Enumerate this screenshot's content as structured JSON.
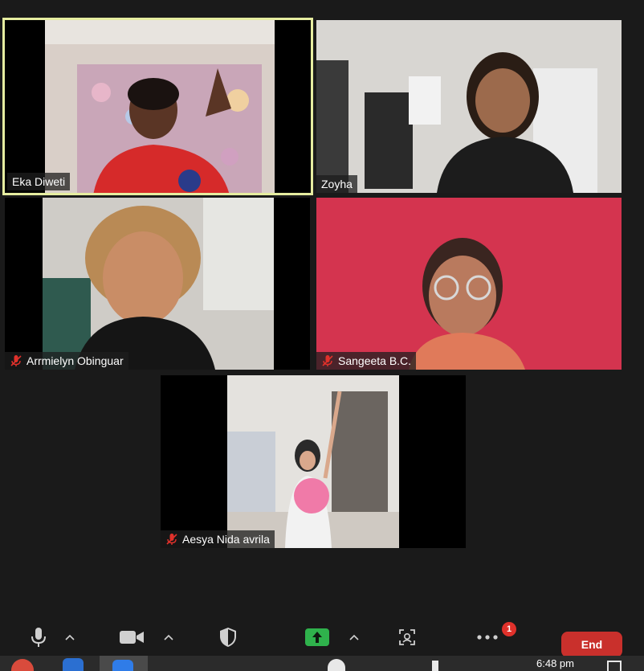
{
  "participants": [
    {
      "name": "Eka Diweti",
      "muted": false,
      "active": true
    },
    {
      "name": "Zoyha",
      "muted": false,
      "active": false
    },
    {
      "name": "Arrmielyn Obinguar",
      "muted": true,
      "active": false
    },
    {
      "name": "Sangeeta B.C.",
      "muted": true,
      "active": false
    },
    {
      "name": "Aesya Nida avrila",
      "muted": true,
      "active": false
    }
  ],
  "toolbar": {
    "end_label": "End",
    "more_badge": "1",
    "icons": [
      "microphone-icon",
      "video-camera-icon",
      "shield-icon",
      "share-screen-icon",
      "reactions-icon",
      "more-icon"
    ]
  },
  "taskbar": {
    "clock": "6:48 pm"
  },
  "colors": {
    "active_border": "#e6eda0",
    "end_button": "#c9302c",
    "share_green": "#2fb24c",
    "muted_red": "#e0312b",
    "tile_red_bg": "#d4344f"
  }
}
